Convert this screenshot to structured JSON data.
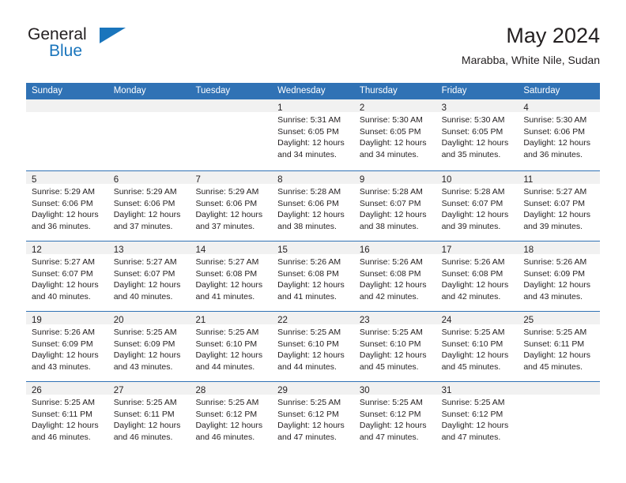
{
  "brand": {
    "name_part1": "General",
    "name_part2": "Blue",
    "logo_icon": "triangle-icon",
    "accent_color": "#1a75bc"
  },
  "header": {
    "title": "May 2024",
    "location": "Marabba, White Nile, Sudan"
  },
  "theme": {
    "header_row_color": "#3072b5",
    "day_band_color": "#f1f1f1",
    "text_color": "#231f20"
  },
  "calendar": {
    "weekdays": [
      "Sunday",
      "Monday",
      "Tuesday",
      "Wednesday",
      "Thursday",
      "Friday",
      "Saturday"
    ],
    "weeks": [
      [
        {
          "day": "",
          "lines": []
        },
        {
          "day": "",
          "lines": []
        },
        {
          "day": "",
          "lines": []
        },
        {
          "day": "1",
          "lines": [
            "Sunrise: 5:31 AM",
            "Sunset: 6:05 PM",
            "Daylight: 12 hours",
            "and 34 minutes."
          ]
        },
        {
          "day": "2",
          "lines": [
            "Sunrise: 5:30 AM",
            "Sunset: 6:05 PM",
            "Daylight: 12 hours",
            "and 34 minutes."
          ]
        },
        {
          "day": "3",
          "lines": [
            "Sunrise: 5:30 AM",
            "Sunset: 6:05 PM",
            "Daylight: 12 hours",
            "and 35 minutes."
          ]
        },
        {
          "day": "4",
          "lines": [
            "Sunrise: 5:30 AM",
            "Sunset: 6:06 PM",
            "Daylight: 12 hours",
            "and 36 minutes."
          ]
        }
      ],
      [
        {
          "day": "5",
          "lines": [
            "Sunrise: 5:29 AM",
            "Sunset: 6:06 PM",
            "Daylight: 12 hours",
            "and 36 minutes."
          ]
        },
        {
          "day": "6",
          "lines": [
            "Sunrise: 5:29 AM",
            "Sunset: 6:06 PM",
            "Daylight: 12 hours",
            "and 37 minutes."
          ]
        },
        {
          "day": "7",
          "lines": [
            "Sunrise: 5:29 AM",
            "Sunset: 6:06 PM",
            "Daylight: 12 hours",
            "and 37 minutes."
          ]
        },
        {
          "day": "8",
          "lines": [
            "Sunrise: 5:28 AM",
            "Sunset: 6:06 PM",
            "Daylight: 12 hours",
            "and 38 minutes."
          ]
        },
        {
          "day": "9",
          "lines": [
            "Sunrise: 5:28 AM",
            "Sunset: 6:07 PM",
            "Daylight: 12 hours",
            "and 38 minutes."
          ]
        },
        {
          "day": "10",
          "lines": [
            "Sunrise: 5:28 AM",
            "Sunset: 6:07 PM",
            "Daylight: 12 hours",
            "and 39 minutes."
          ]
        },
        {
          "day": "11",
          "lines": [
            "Sunrise: 5:27 AM",
            "Sunset: 6:07 PM",
            "Daylight: 12 hours",
            "and 39 minutes."
          ]
        }
      ],
      [
        {
          "day": "12",
          "lines": [
            "Sunrise: 5:27 AM",
            "Sunset: 6:07 PM",
            "Daylight: 12 hours",
            "and 40 minutes."
          ]
        },
        {
          "day": "13",
          "lines": [
            "Sunrise: 5:27 AM",
            "Sunset: 6:07 PM",
            "Daylight: 12 hours",
            "and 40 minutes."
          ]
        },
        {
          "day": "14",
          "lines": [
            "Sunrise: 5:27 AM",
            "Sunset: 6:08 PM",
            "Daylight: 12 hours",
            "and 41 minutes."
          ]
        },
        {
          "day": "15",
          "lines": [
            "Sunrise: 5:26 AM",
            "Sunset: 6:08 PM",
            "Daylight: 12 hours",
            "and 41 minutes."
          ]
        },
        {
          "day": "16",
          "lines": [
            "Sunrise: 5:26 AM",
            "Sunset: 6:08 PM",
            "Daylight: 12 hours",
            "and 42 minutes."
          ]
        },
        {
          "day": "17",
          "lines": [
            "Sunrise: 5:26 AM",
            "Sunset: 6:08 PM",
            "Daylight: 12 hours",
            "and 42 minutes."
          ]
        },
        {
          "day": "18",
          "lines": [
            "Sunrise: 5:26 AM",
            "Sunset: 6:09 PM",
            "Daylight: 12 hours",
            "and 43 minutes."
          ]
        }
      ],
      [
        {
          "day": "19",
          "lines": [
            "Sunrise: 5:26 AM",
            "Sunset: 6:09 PM",
            "Daylight: 12 hours",
            "and 43 minutes."
          ]
        },
        {
          "day": "20",
          "lines": [
            "Sunrise: 5:25 AM",
            "Sunset: 6:09 PM",
            "Daylight: 12 hours",
            "and 43 minutes."
          ]
        },
        {
          "day": "21",
          "lines": [
            "Sunrise: 5:25 AM",
            "Sunset: 6:10 PM",
            "Daylight: 12 hours",
            "and 44 minutes."
          ]
        },
        {
          "day": "22",
          "lines": [
            "Sunrise: 5:25 AM",
            "Sunset: 6:10 PM",
            "Daylight: 12 hours",
            "and 44 minutes."
          ]
        },
        {
          "day": "23",
          "lines": [
            "Sunrise: 5:25 AM",
            "Sunset: 6:10 PM",
            "Daylight: 12 hours",
            "and 45 minutes."
          ]
        },
        {
          "day": "24",
          "lines": [
            "Sunrise: 5:25 AM",
            "Sunset: 6:10 PM",
            "Daylight: 12 hours",
            "and 45 minutes."
          ]
        },
        {
          "day": "25",
          "lines": [
            "Sunrise: 5:25 AM",
            "Sunset: 6:11 PM",
            "Daylight: 12 hours",
            "and 45 minutes."
          ]
        }
      ],
      [
        {
          "day": "26",
          "lines": [
            "Sunrise: 5:25 AM",
            "Sunset: 6:11 PM",
            "Daylight: 12 hours",
            "and 46 minutes."
          ]
        },
        {
          "day": "27",
          "lines": [
            "Sunrise: 5:25 AM",
            "Sunset: 6:11 PM",
            "Daylight: 12 hours",
            "and 46 minutes."
          ]
        },
        {
          "day": "28",
          "lines": [
            "Sunrise: 5:25 AM",
            "Sunset: 6:12 PM",
            "Daylight: 12 hours",
            "and 46 minutes."
          ]
        },
        {
          "day": "29",
          "lines": [
            "Sunrise: 5:25 AM",
            "Sunset: 6:12 PM",
            "Daylight: 12 hours",
            "and 47 minutes."
          ]
        },
        {
          "day": "30",
          "lines": [
            "Sunrise: 5:25 AM",
            "Sunset: 6:12 PM",
            "Daylight: 12 hours",
            "and 47 minutes."
          ]
        },
        {
          "day": "31",
          "lines": [
            "Sunrise: 5:25 AM",
            "Sunset: 6:12 PM",
            "Daylight: 12 hours",
            "and 47 minutes."
          ]
        },
        {
          "day": "",
          "lines": []
        }
      ]
    ]
  }
}
